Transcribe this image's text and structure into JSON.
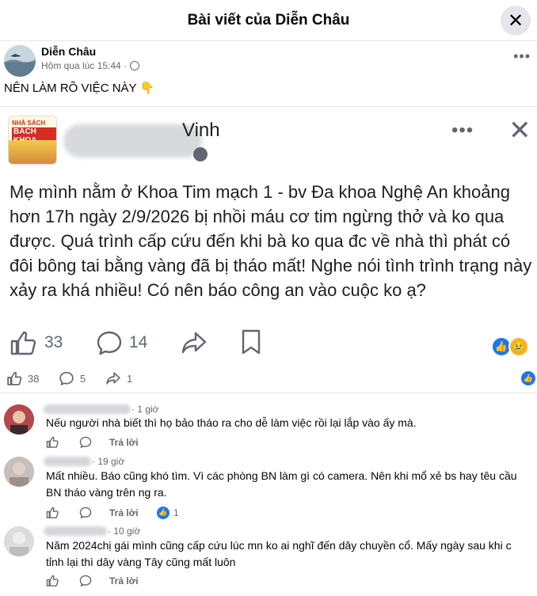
{
  "header": {
    "title": "Bài viết của Diễn Châu",
    "close_icon": "close-icon"
  },
  "post": {
    "author": "Diễn Châu",
    "time": "Hôm qua lúc 15:44 ·",
    "privacy_icon": "globe-icon",
    "more_icon": "more-icon",
    "text": "NÊN LÀM RÕ VIỆC NÀY",
    "emoji": "👇"
  },
  "shared_screenshot": {
    "page_name_visible": "Vinh",
    "logo_top": "NHÀ SÁCH",
    "logo_bottom": "BÁCH KHOA",
    "body": "Mẹ mình nằm ở Khoa Tim mạch 1 - bv Đa khoa Nghệ An khoảng hơn 17h ngày 2/9/2026 bị nhồi máu cơ tim ngừng thở và ko qua được. Quá trình cấp cứu đến khi bà ko qua đc về nhà thì phát có đôi bông tai bằng vàng đã bị  tháo mất! Nghe nói tình trình trạng này xảy ra khá nhiều! Có nên báo công an vào cuộc ko ạ?",
    "likes": "33",
    "comments": "14"
  },
  "stats": {
    "likes": "38",
    "comments": "5",
    "shares": "1"
  },
  "comments": [
    {
      "time": "· 1 giờ",
      "text": "Nếu người nhà biết thì họ bảo tháo ra cho dễ làm việc rồi lại lắp vào ấy mà.",
      "reply": "Trả lời",
      "reactions": ""
    },
    {
      "time": "· 19 giờ",
      "text": "Mất nhiều. Báo cũng khó tìm. Vì các phòng BN làm gì có camera. Nên khi mổ xẻ bs hay têu cầu BN tháo vàng trên ng ra.",
      "reply": "Trả lời",
      "reactions": "1"
    },
    {
      "time": "· 10 giờ",
      "text": "Năm 2024chị gái mình cũng cấp cứu lúc mn ko ai nghĩ đến dây chuyền cổ. Mấy ngày sau khi c tỉnh lại thì dây vàng Tây cũng mất luôn",
      "reply": "Trả lời",
      "reactions": ""
    }
  ],
  "colors": {
    "accent": "#1877f2",
    "muted": "#65676b",
    "divider": "#e4e6eb"
  }
}
